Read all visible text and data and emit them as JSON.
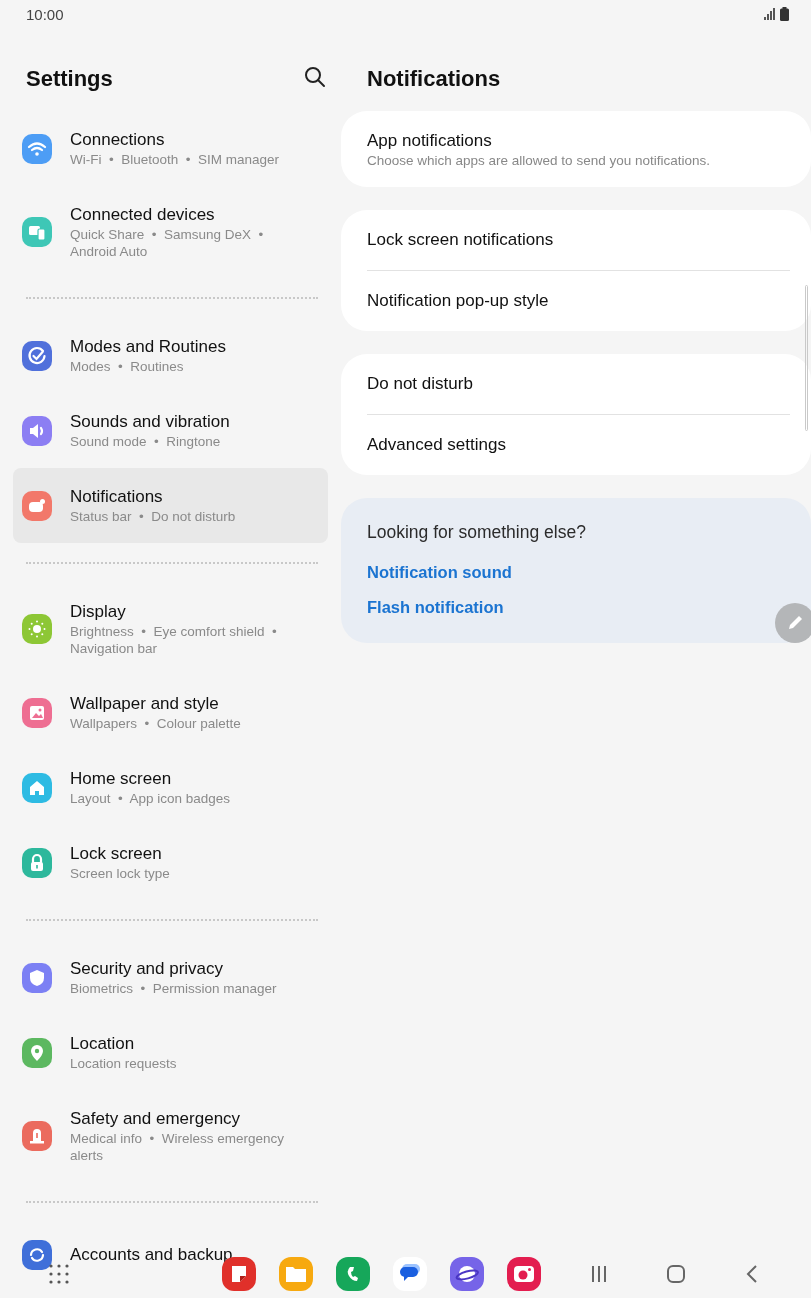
{
  "status_bar": {
    "time": "10:00"
  },
  "sidebar": {
    "title": "Settings",
    "groups": [
      [
        {
          "title": "Connections",
          "subtitle": "Wi-Fi  •  Bluetooth  •  SIM manager",
          "color": "#4d9df5",
          "selected": false
        },
        {
          "title": "Connected devices",
          "subtitle": "Quick Share  •  Samsung DeX  •  Android Auto",
          "color": "#3ec7b6",
          "selected": false
        }
      ],
      [
        {
          "title": "Modes and Routines",
          "subtitle": "Modes  •  Routines",
          "color": "#5070db",
          "selected": false
        },
        {
          "title": "Sounds and vibration",
          "subtitle": "Sound mode  •  Ringtone",
          "color": "#8c7ef3",
          "selected": false
        },
        {
          "title": "Notifications",
          "subtitle": "Status bar  •  Do not disturb",
          "color": "#f2786a",
          "selected": true
        }
      ],
      [
        {
          "title": "Display",
          "subtitle": "Brightness  •  Eye comfort shield  •  Navigation bar",
          "color": "#8dc735",
          "selected": false
        },
        {
          "title": "Wallpaper and style",
          "subtitle": "Wallpapers  •  Colour palette",
          "color": "#ee6e92",
          "selected": false
        },
        {
          "title": "Home screen",
          "subtitle": "Layout  •  App icon badges",
          "color": "#2ebbe3",
          "selected": false
        },
        {
          "title": "Lock screen",
          "subtitle": "Screen lock type",
          "color": "#2db89c",
          "selected": false
        }
      ],
      [
        {
          "title": "Security and privacy",
          "subtitle": "Biometrics  •  Permission manager",
          "color": "#7c80f4",
          "selected": false
        },
        {
          "title": "Location",
          "subtitle": "Location requests",
          "color": "#5cb860",
          "selected": false
        },
        {
          "title": "Safety and emergency",
          "subtitle": "Medical info  •  Wireless emergency alerts",
          "color": "#eb6b5e",
          "selected": false
        }
      ],
      [
        {
          "title": "Accounts and backup",
          "color": "#3f6fd9",
          "selected": false
        }
      ]
    ]
  },
  "detail": {
    "title": "Notifications",
    "cards": [
      {
        "rows": [
          {
            "title": "App notifications",
            "subtitle": "Choose which apps are allowed to send you notifications."
          }
        ]
      },
      {
        "rows": [
          {
            "title": "Lock screen notifications"
          },
          {
            "title": "Notification pop-up style"
          }
        ]
      },
      {
        "rows": [
          {
            "title": "Do not disturb"
          },
          {
            "title": "Advanced settings"
          }
        ]
      }
    ],
    "suggestions": {
      "title": "Looking for something else?",
      "links": [
        "Notification sound",
        "Flash notification"
      ]
    }
  }
}
